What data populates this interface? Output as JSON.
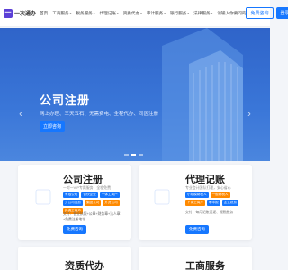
{
  "header": {
    "logo_mark": "一",
    "logo_text": "一次通办",
    "nav": [
      {
        "label": "首页",
        "chev": ""
      },
      {
        "label": "工商服务",
        "chev": "▾"
      },
      {
        "label": "税务服务",
        "chev": "▾"
      },
      {
        "label": "代理记账",
        "chev": "▾"
      },
      {
        "label": "资质代办",
        "chev": "▾"
      },
      {
        "label": "审计服务",
        "chev": "▾"
      },
      {
        "label": "银行服务",
        "chev": "▾"
      },
      {
        "label": "法律服务",
        "chev": "▾"
      },
      {
        "label": "请输入你要问的",
        "chev": ""
      }
    ],
    "consult": "免费咨询",
    "login": "登录"
  },
  "hero": {
    "title": "公司注册",
    "subtitle": "网上办理、三天五石、无需费电、全程代办、同区注册",
    "button": "立即咨询",
    "prev": "‹",
    "next": "›",
    "slides": 3,
    "active_slide": 1
  },
  "cards": [
    {
      "title": "公司注册",
      "desc": "一对一VIP专属服务，全程免费",
      "tags": [
        {
          "label": "有限公司",
          "color": "#1677ff"
        },
        {
          "label": "合伙企业",
          "color": "#1677ff"
        },
        {
          "label": "个体工商户",
          "color": "#1677ff"
        },
        {
          "label": "分公司注册",
          "color": "#1677ff"
        },
        {
          "label": "集团公司",
          "color": "#ff8a00"
        },
        {
          "label": "外资公司",
          "color": "#ff8a00"
        },
        {
          "label": "外资工商户",
          "color": "#ff8a00"
        }
      ],
      "notes": [
        "交付：营业执照+公章+财务章+法人章",
        "+免费注册地址"
      ],
      "button": "免费咨询"
    },
    {
      "title": "代理记账",
      "desc": "专业会计团队打理，安心省心",
      "tags": [
        {
          "label": "小规模纳税人",
          "color": "#1677ff"
        },
        {
          "label": "一般纳税人",
          "color": "#ff8a00"
        },
        {
          "label": "个体工商户",
          "color": "#ff8a00"
        },
        {
          "label": "零申报",
          "color": "#1677ff"
        },
        {
          "label": "企业税务",
          "color": "#1677ff"
        }
      ],
      "notes": [
        "交付：每月记账凭证、报税服务"
      ],
      "button": "免费咨询"
    },
    {
      "title": "资质代办"
    },
    {
      "title": "工商服务"
    }
  ]
}
